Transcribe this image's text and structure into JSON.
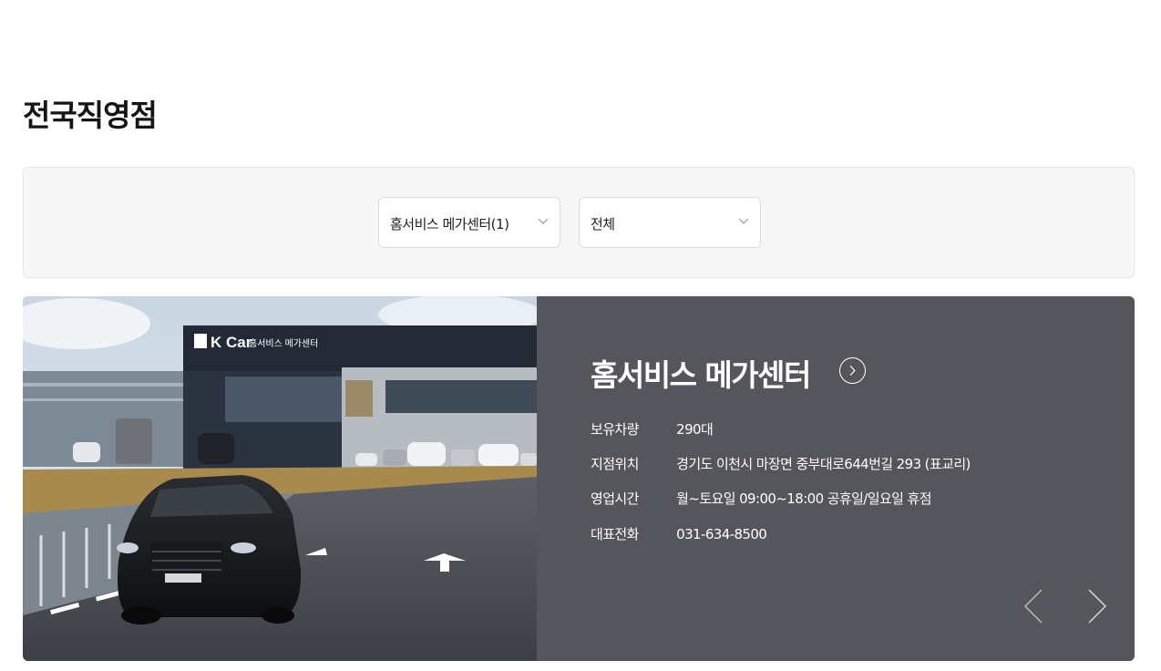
{
  "page": {
    "title": "전국직영점"
  },
  "filters": {
    "region": {
      "selected": "홈서비스 메가센터(1)"
    },
    "type": {
      "selected": "전체"
    }
  },
  "center": {
    "name": "홈서비스 메가센터",
    "photo_sign": {
      "brand": "K Car",
      "label": "홈서비스 메가센터"
    },
    "rows": [
      {
        "label": "보유차량",
        "value": "290대"
      },
      {
        "label": "지점위치",
        "value": "경기도 이천시 마장면 중부대로644번길 293 (표교리)"
      },
      {
        "label": "영업시간",
        "value": "월~토요일 09:00~18:00 공휴일/일요일 휴점"
      },
      {
        "label": "대표전화",
        "value": "031-634-8500"
      }
    ]
  },
  "colors": {
    "card_bg": "#55565b",
    "panel_bg": "#f7f7f7",
    "title": "#151515"
  }
}
